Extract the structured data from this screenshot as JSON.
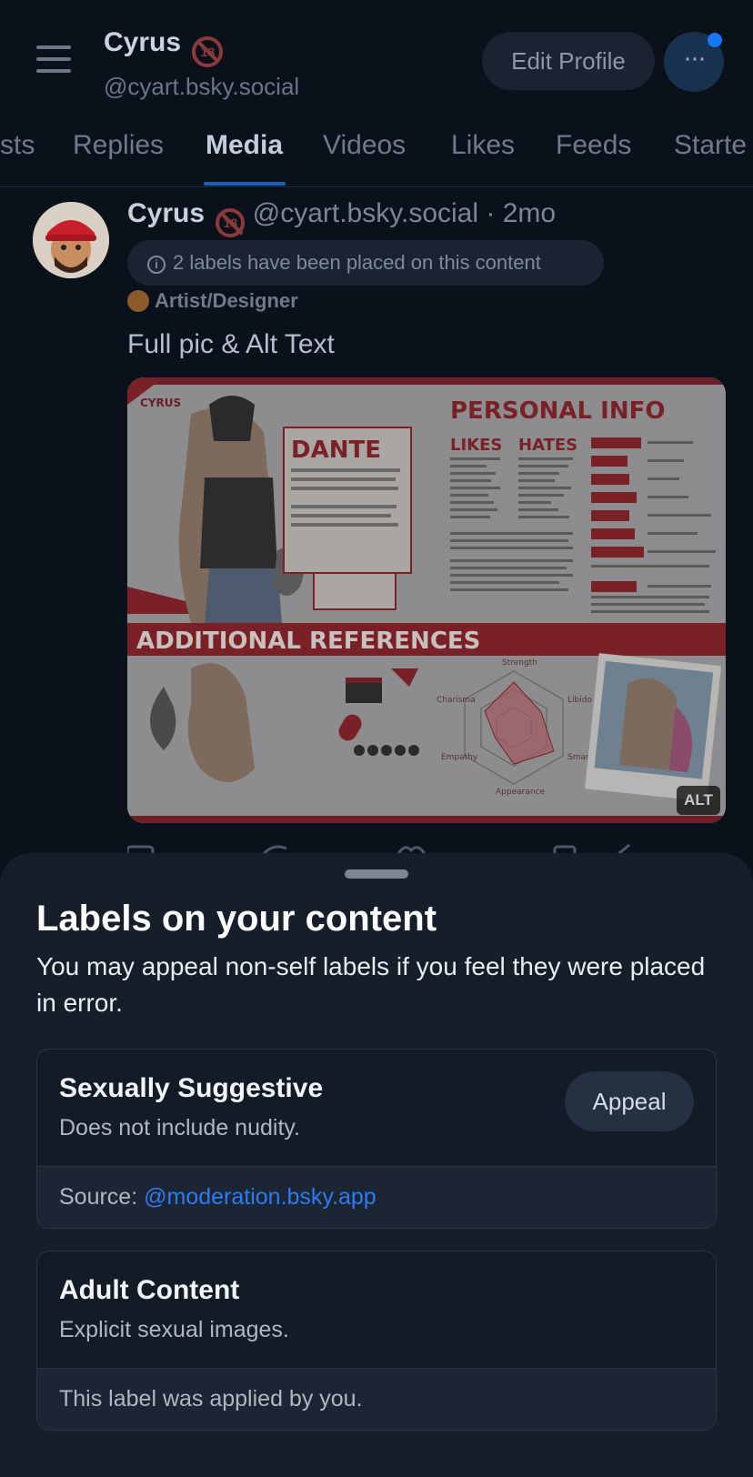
{
  "header": {
    "name": "Cyrus",
    "badge": "18",
    "handle": "@cyart.bsky.social",
    "edit_label": "Edit Profile",
    "more_label": "···"
  },
  "tabs": [
    {
      "label": "Posts",
      "visible": "sts"
    },
    {
      "label": "Replies",
      "visible": "Replies"
    },
    {
      "label": "Media",
      "visible": "Media",
      "active": true
    },
    {
      "label": "Videos",
      "visible": "Videos"
    },
    {
      "label": "Likes",
      "visible": "Likes"
    },
    {
      "label": "Feeds",
      "visible": "Feeds"
    },
    {
      "label": "Starter Packs",
      "visible": "Starte"
    }
  ],
  "post": {
    "author": "Cyrus",
    "handle": "@cyart.bsky.social",
    "sep": "·",
    "time": "2mo",
    "labels_notice": "2 labels have been placed on this content",
    "self_label": "Artist/Designer",
    "text": "Full pic & Alt Text",
    "alt_badge": "ALT",
    "image": {
      "watermark": "CYRUS",
      "heading": "PERSONAL INFO",
      "char_name": "DANTE",
      "likes_title": "LIKES",
      "hates_title": "HATES",
      "section": "ADDITIONAL REFERENCES",
      "stats": [
        "Strength",
        "Libido",
        "Smarts",
        "Appearance",
        "Empathy",
        "Charisma"
      ]
    }
  },
  "sheet": {
    "title": "Labels on your content",
    "description": "You may appeal non-self labels if you feel they were placed in error.",
    "labels": [
      {
        "title": "Sexually Suggestive",
        "subtitle": "Does not include nudity.",
        "appeal_label": "Appeal",
        "source_prefix": "Source: ",
        "source_link": "@moderation.bsky.app"
      },
      {
        "title": "Adult Content",
        "subtitle": "Explicit sexual images.",
        "footer": "This label was applied by you."
      }
    ]
  },
  "colors": {
    "accent": "#2e7bf0",
    "notif_dot": "#1877f2",
    "background": "#0b111b",
    "sheet": "#161e2a"
  }
}
